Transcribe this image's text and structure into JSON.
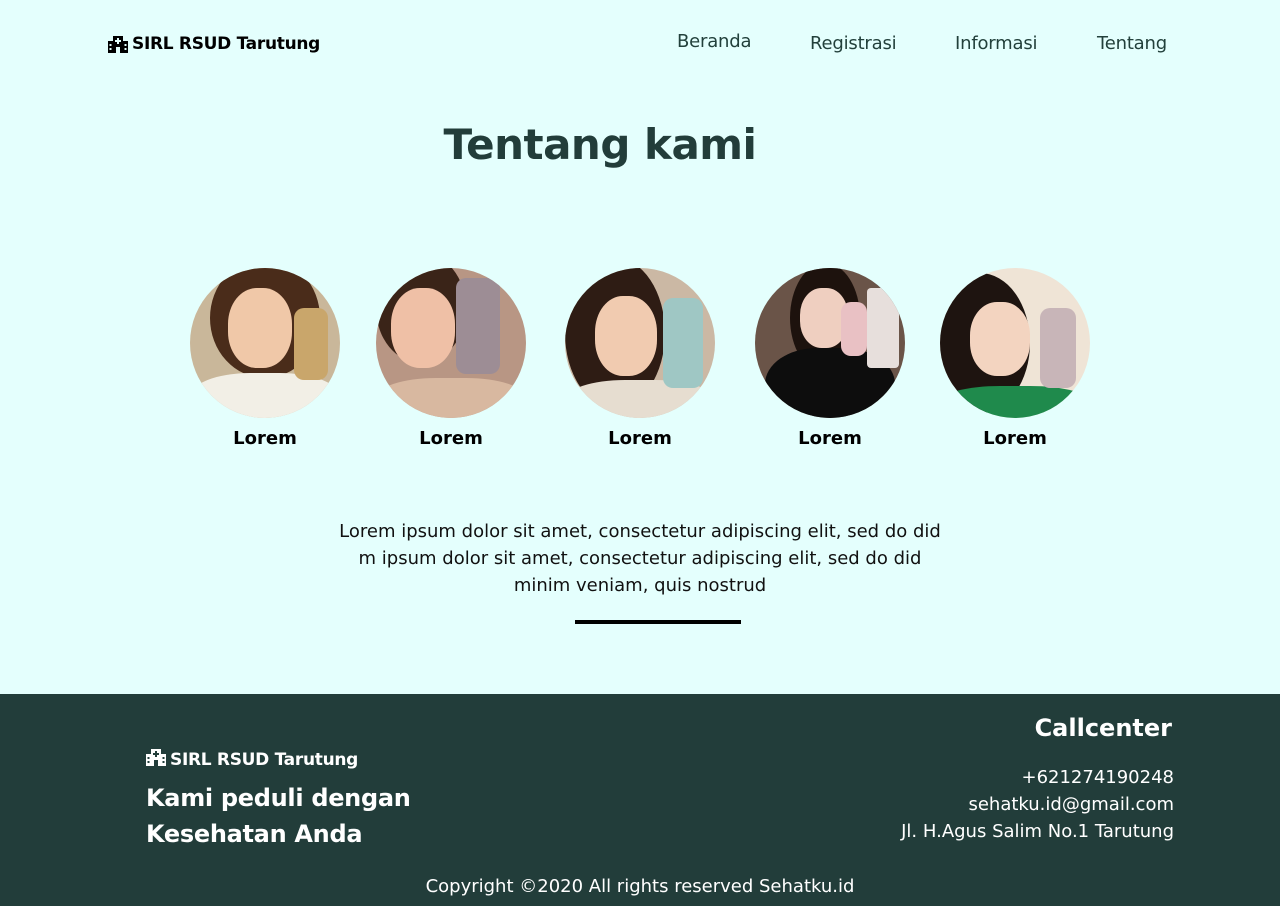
{
  "header": {
    "brand": "SIRL RSUD Tarutung",
    "brand_icon": "hospital-icon",
    "nav": [
      {
        "label": "Beranda"
      },
      {
        "label": "Registrasi"
      },
      {
        "label": "Informasi"
      },
      {
        "label": "Tentang"
      }
    ]
  },
  "main": {
    "title": "Tentang kami",
    "team": [
      {
        "name": "Lorem"
      },
      {
        "name": "Lorem"
      },
      {
        "name": "Lorem"
      },
      {
        "name": "Lorem"
      },
      {
        "name": "Lorem"
      }
    ],
    "description": "Lorem ipsum dolor sit amet, consectetur adipiscing elit, sed do did m ipsum dolor sit amet, consectetur adipiscing elit, sed do did minim veniam, quis nostrud"
  },
  "footer": {
    "brand": "SIRL RSUD Tarutung",
    "tagline": "Kami peduli dengan Kesehatan Anda",
    "callcenter_title": "Callcenter",
    "phone": "+621274190248",
    "email": "sehatku.id@gmail.com",
    "address": "Jl. H.Agus Salim No.1 Tarutung",
    "copyright": "Copyright ©2020 All rights reserved Sehatku.id"
  },
  "colors": {
    "page_background": "#e4fffd",
    "footer_background": "#223d3a",
    "title_color": "#223d3a"
  }
}
